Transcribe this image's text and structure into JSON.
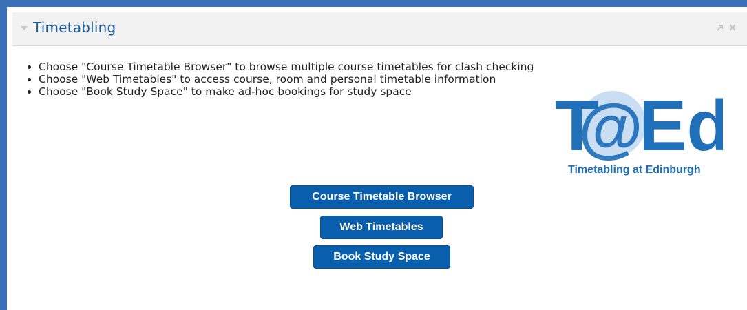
{
  "block": {
    "title": "Timetabling",
    "collapse_icon": "chevron-down-icon",
    "dock_icon": "dock-icon",
    "close_icon": "close-icon"
  },
  "instructions": [
    "Choose \"Course Timetable Browser\" to browse multiple course timetables for clash checking",
    "Choose \"Web Timetables\" to access course, room and personal timetable information",
    "Choose \"Book Study Space\" to make ad-hoc bookings for study space"
  ],
  "logo": {
    "main_text_left": "T",
    "at_symbol": "@",
    "main_text_right": "Ed",
    "tagline": "Timetabling at Edinburgh",
    "colors": {
      "blue": "#1f6fb9",
      "light_blue": "#9ec3e6"
    }
  },
  "buttons": [
    {
      "label": "Course Timetable Browser"
    },
    {
      "label": "Web Timetables"
    },
    {
      "label": "Book Study Space"
    }
  ],
  "colors": {
    "frame": "#3b6fb6",
    "header_bg": "#f2f2f2",
    "title": "#1a5a96",
    "button_bg": "#0a5fad"
  }
}
